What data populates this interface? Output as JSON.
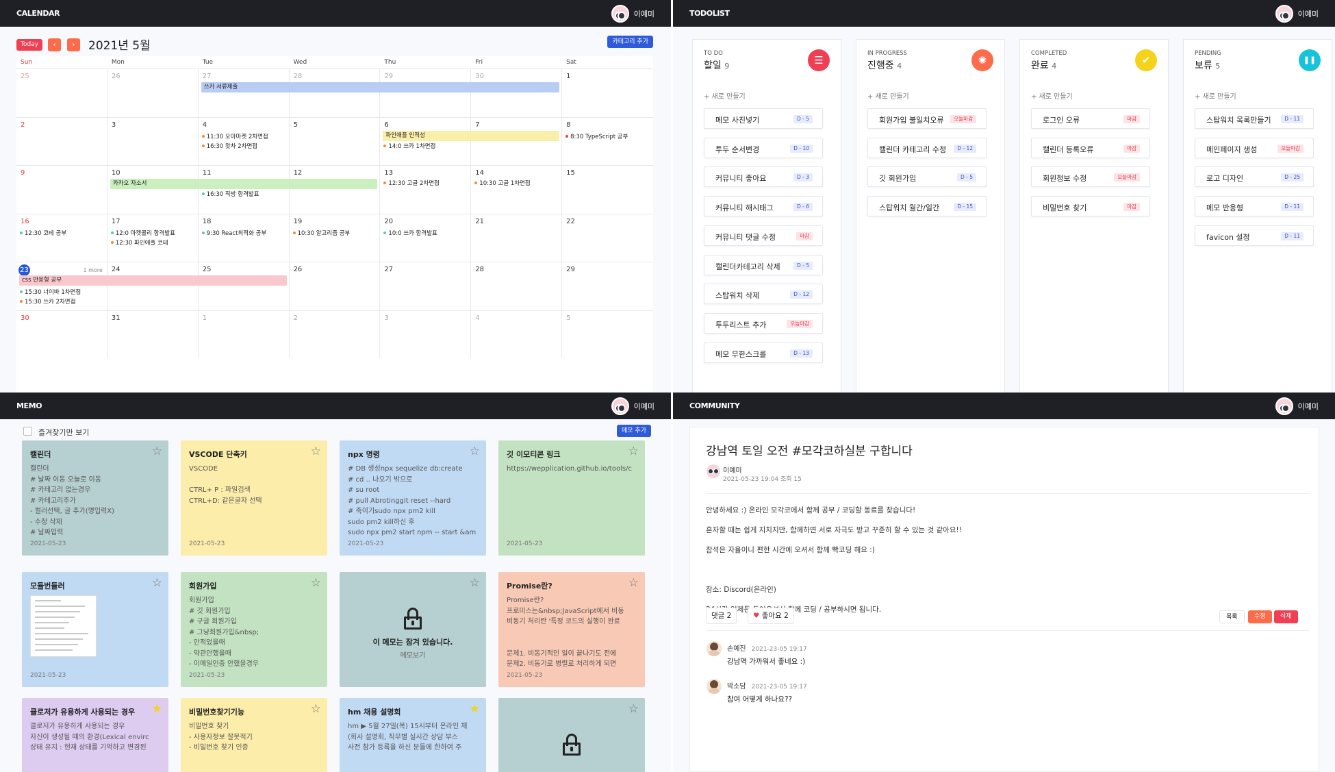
{
  "user_name": "이예미",
  "calendar": {
    "header": "CALENDAR",
    "today_label": "Today",
    "prev": "‹",
    "next": "›",
    "month_title": "2021년 5월",
    "add_category": "카테고리 추가",
    "weekdays": [
      "Sun",
      "Mon",
      "Tue",
      "Wed",
      "Thu",
      "Fri",
      "Sat"
    ],
    "weeks": [
      [
        "25",
        "26",
        "27",
        "28",
        "29",
        "30",
        "1"
      ],
      [
        "2",
        "3",
        "4",
        "5",
        "6",
        "7",
        "8"
      ],
      [
        "9",
        "10",
        "11",
        "12",
        "13",
        "14",
        "15"
      ],
      [
        "16",
        "17",
        "18",
        "19",
        "20",
        "21",
        "22"
      ],
      [
        "23",
        "24",
        "25",
        "26",
        "27",
        "28",
        "29"
      ],
      [
        "30",
        "31",
        "1",
        "2",
        "3",
        "4",
        "5"
      ]
    ],
    "more_label": "1 more",
    "bars": [
      "쓰카 서류제출",
      "파인애플 인적성",
      "카카오 자소서",
      "css 반응형 공부"
    ],
    "events": [
      "11:30 오아마켓 2차면접",
      "16:30 왓차 2차면접",
      "14:0 쓰카 1차면접",
      "8:30 TypeScript 공부",
      "16:30 직방 합격발표",
      "12:30 고글 2차면접",
      "10:30 고글 1차면접",
      "12:30 코테 공부",
      "12:0 마켓콜리 합격발표",
      "12:30 파인애플 코테",
      "9:30 React최적화 공부",
      "10:30 알고리즘 공부",
      "10:0 쓰카 합격발표",
      "15:30 너이바 1차면접",
      "15:30 쓰카 2차면접"
    ],
    "colors": {
      "red": "#ef3f53",
      "orange": "#fd6c4a",
      "blue": "#2f5bd9",
      "today": "#2459d6"
    }
  },
  "todo": {
    "header": "TODOLIST",
    "add_new": "+ 새로 만들기",
    "columns": [
      {
        "label": "TO DO",
        "title": "할일",
        "count": "9",
        "icon": "list-icon",
        "color": "#ef3f53",
        "cards": [
          {
            "text": "메모 사진넣기",
            "badge": "D - 5"
          },
          {
            "text": "투두 순서변경",
            "badge": "D - 10"
          },
          {
            "text": "커뮤니티 좋아요",
            "badge": "D - 3"
          },
          {
            "text": "커뮤니티 해시태그",
            "badge": "D - 6"
          },
          {
            "text": "커뮤니티 댓글 수정",
            "badge": "마감"
          },
          {
            "text": "캘린더카테고리 삭제",
            "badge": "D - 5"
          },
          {
            "text": "스탑워치 삭제",
            "badge": "D - 12"
          },
          {
            "text": "투두리스트 추가",
            "badge": "오늘마감"
          },
          {
            "text": "메모 무한스크롤",
            "badge": "D - 13"
          }
        ]
      },
      {
        "label": "IN PROGRESS",
        "title": "진행중",
        "count": "4",
        "icon": "progress-icon",
        "color": "#fd6c4a",
        "cards": [
          {
            "text": "회원가입 불일치오류",
            "badge": "오늘마감"
          },
          {
            "text": "캘린더 카테고리 수정",
            "badge": "D - 12"
          },
          {
            "text": "깃 회원가입",
            "badge": "D - 5"
          },
          {
            "text": "스탑워치 월간/일간",
            "badge": "D - 15"
          }
        ]
      },
      {
        "label": "COMPLETED",
        "title": "완료",
        "count": "4",
        "icon": "check-icon",
        "color": "#f5d31a",
        "cards": [
          {
            "text": "로그인 오류",
            "badge": "마감"
          },
          {
            "text": "캘린더 등록오류",
            "badge": "마감"
          },
          {
            "text": "회원정보 수정",
            "badge": "오늘마감"
          },
          {
            "text": "비밀번호 찾기",
            "badge": "마감"
          }
        ]
      },
      {
        "label": "PENDING",
        "title": "보류",
        "count": "5",
        "icon": "pause-icon",
        "color": "#16c3d8",
        "cards": [
          {
            "text": "스탑워치 목록만들기",
            "badge": "D - 11"
          },
          {
            "text": "메인페이지 생성",
            "badge": "오늘마감"
          },
          {
            "text": "로고 디자인",
            "badge": "D - 25"
          },
          {
            "text": "메모 반응형",
            "badge": "D - 11"
          },
          {
            "text": "favicon 설정",
            "badge": "D - 11"
          }
        ]
      }
    ]
  },
  "memo": {
    "header": "MEMO",
    "favorites_only": "즐겨찾기만 보기",
    "add_memo": "메모 추가",
    "locked_text": "이 메모는 잠겨 있습니다.",
    "locked_link": "메모보기",
    "items": [
      {
        "title": "캘린더",
        "body": "캘린더\n# 날짜 이동 오늘로 이동\n# 카테고리 없는경우\n# 카테고리추가\n- 컬러선택, 글 추가(명입력X)\n- 수정 삭제\n# 날짜입력",
        "date": "2021-05-23",
        "color": "#b6cfd0",
        "star": false
      },
      {
        "title": "VSCODE 단축키",
        "body": "VSCODE\n\nCTRL+ P : 파일검색\nCTRL+D: 같은글자 선택",
        "date": "2021-05-23",
        "color": "#fcedaa",
        "star": false
      },
      {
        "title": "npx 명령",
        "body": "# DB 생성npx sequelize db:create\n# cd .. 나오기 밖으로\n# su root\n# pull Abrotinggit reset --hard\n# 죽이기sudo npx pm2 kill\nsudo pm2 kill하신 후\nsudo npx pm2 start npm -- start &am",
        "date": "2021-05-23",
        "color": "#c1daf3",
        "star": false
      },
      {
        "title": "깃 이모티콘 링크",
        "body": "https://wepplication.github.io/tools/c",
        "date": "2021-05-23",
        "color": "#c3e2c2",
        "star": false
      },
      {
        "title": "모듈번들러",
        "body": "",
        "date": "2021-05-23",
        "color": "#c1daf3",
        "star": false
      },
      {
        "title": "회원가입",
        "body": "회원가입\n# 깃 회원가입\n# 구글 회원가입\n# 그냥회원가입&nbsp;\n- 안적었을때\n- 약관안했을때\n- 이메일인증 안했을경우",
        "date": "2021-05-23",
        "color": "#c3e2c2",
        "star": false
      },
      {
        "title": "",
        "body": "",
        "date": "",
        "color": "#b6cfd0",
        "star": false,
        "locked": true
      },
      {
        "title": "Promise란?",
        "body": "Promise란?\n프로미스는&nbsp;JavaScript에서 비동\n비동기 처리란 '특정 코드의 실행이 완료\n\n\n문제1. 비동기적인 일이 끝나기도 전에\n문제2. 비동기로 병렬로 처리하게 되면",
        "date": "2021-05-23",
        "color": "#f8c9b5",
        "star": false
      },
      {
        "title": "클로저가 유용하게 사용되는 경우",
        "body": "클로저가 유용하게 사용되는 경우\n자신이 생성될 때의 환경(Lexical envirc\n상태 유지 : 현재 상태를 기억하고 변경된",
        "date": "",
        "color": "#ddccf0",
        "star": true
      },
      {
        "title": "비밀번호찾기기능",
        "body": "비밀번호 찾기\n- 사용자정보 잘못적기\n- 비밀번호 찾기 인증",
        "date": "",
        "color": "#fcedaa",
        "star": false
      },
      {
        "title": "hm 채용 설명회",
        "body": "hm ▶ 5월 27일(목) 15시부터 온라인 채\n(회사 설명회, 직무별 실시간 상담 부스\n사전 참가 등록을 하신 분들에 한하여 주",
        "date": "",
        "color": "#c1daf3",
        "star": true
      },
      {
        "title": "",
        "body": "",
        "date": "",
        "color": "#b6cfd0",
        "star": false,
        "locked": true
      }
    ]
  },
  "community": {
    "header": "COMMUNITY",
    "title": "강남역 토일 오전 #모각코하실분 구합니다",
    "author": "이예미",
    "meta": "2021-05-23 19:04  조회 15",
    "body": [
      "안녕하세요 :) 온라인 모각코에서 함께 공부 / 코딩할 동료를 찾습니다!",
      "혼자할 때는 쉽게 지치지만, 함께하면 서로 자극도 받고 꾸준히 할 수 있는 것 같아요!!",
      "참석은 자율이니 편한 시간에 오셔서 함께 빡코딩 해요 :)",
      "",
      "장소: Discord(온라인)",
      "24시간 언제든 들어오셔서 함께 코딩 / 공부하시면 됩니다."
    ],
    "comment_count_label": "댓글 2",
    "like_label": "좋아요 2",
    "list_btn": "목록",
    "edit_btn": "수정",
    "delete_btn": "삭제",
    "comments": [
      {
        "name": "손예진",
        "time": "2021-23-05 19:17",
        "text": "강남역 가까워서 좋네요 :)"
      },
      {
        "name": "박소담",
        "time": "2021-23-05 19:17",
        "text": "참여 어떻게 하나요??"
      }
    ]
  }
}
